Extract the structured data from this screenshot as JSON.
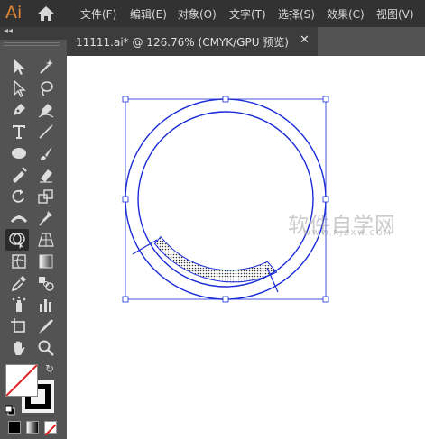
{
  "app": {
    "logo": "Ai"
  },
  "menu": [
    "文件(F)",
    "编辑(E)",
    "对象(O)",
    "文字(T)",
    "选择(S)",
    "效果(C)",
    "视图(V)"
  ],
  "panel": {
    "collapse_glyph": "◂◂"
  },
  "document": {
    "tab_title": "11111.ai* @ 126.76% (CMYK/GPU 预览)",
    "close_glyph": "✕"
  },
  "tools": [
    "selection-tool",
    "direct-selection-tool",
    "magic-wand-tool",
    "lasso-tool",
    "pen-tool",
    "curvature-tool",
    "type-tool",
    "line-segment-tool",
    "ellipse-tool",
    "paintbrush-tool",
    "shaper-tool",
    "eraser-tool",
    "rotate-tool",
    "scale-tool",
    "width-tool",
    "puppet-warp-tool",
    "shape-builder-tool",
    "perspective-grid-tool",
    "mesh-tool",
    "gradient-tool",
    "eyedropper-tool",
    "blend-tool",
    "symbol-sprayer-tool",
    "column-graph-tool",
    "artboard-tool",
    "slice-tool",
    "hand-tool",
    "zoom-tool"
  ],
  "colors": {
    "fill": "none (white with red slash)",
    "stroke": "#000000",
    "selection": "#1a2bd8",
    "accent_logo": "#e0883a"
  },
  "watermark": {
    "main": "软件自学网",
    "sub": "WWW.RJZXW.COM"
  }
}
